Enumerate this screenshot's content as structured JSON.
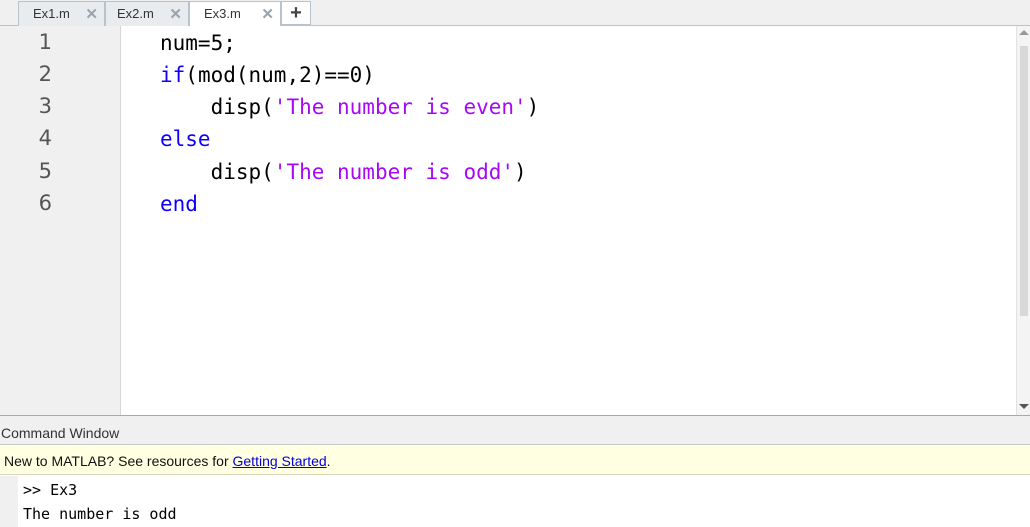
{
  "tabs": [
    {
      "label": "Ex1.m",
      "close": "✕"
    },
    {
      "label": "Ex2.m",
      "close": "✕"
    },
    {
      "label": "Ex3.m",
      "close": "✕",
      "active": true
    }
  ],
  "add_tab": "+",
  "editor": {
    "line_numbers": [
      "1",
      "2",
      "3",
      "4",
      "5",
      "6"
    ],
    "lines": {
      "l1": {
        "text": "num=5;"
      },
      "l2": {
        "kw": "if",
        "rest": "(mod(num,2)==0)"
      },
      "l3": {
        "indent": "    ",
        "pre": "disp(",
        "str": "'The number is even'",
        "post": ")"
      },
      "l4": {
        "kw": "else"
      },
      "l5": {
        "indent": "    ",
        "pre": "disp(",
        "str": "'The number is odd'",
        "post": ")"
      },
      "l6": {
        "kw": "end"
      }
    }
  },
  "command_window": {
    "title": "Command Window",
    "notice_text": "New to MATLAB? See resources for ",
    "notice_link": "Getting Started",
    "notice_end": ".",
    "prompt_line": ">> Ex3",
    "output_line": "The number is odd"
  },
  "colors": {
    "keyword": "#0e00ff",
    "string": "#a709f5",
    "notice_bg": "#ffffe1"
  }
}
